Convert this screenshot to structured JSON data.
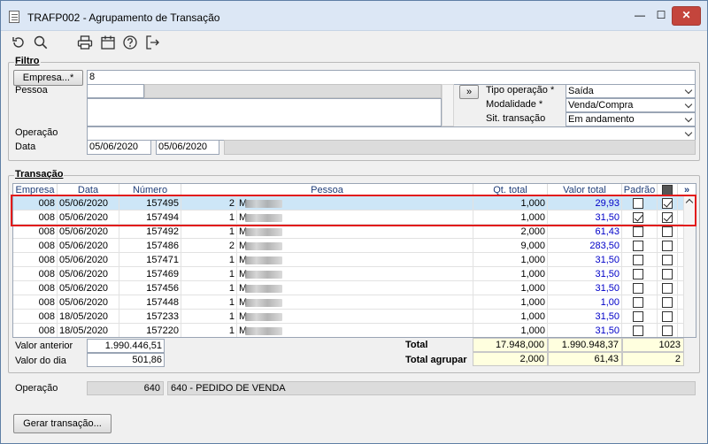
{
  "window": {
    "title": "TRAFP002 - Agrupamento de Transação",
    "minimize": "—",
    "maximize": "☐",
    "close": "✕"
  },
  "toolbar": {
    "icons": [
      "refresh-icon",
      "search-icon",
      "print-icon",
      "calendar-icon",
      "help-icon",
      "exit-icon"
    ]
  },
  "filtro": {
    "group_label": "Filtro",
    "empresa_button": "Empresa...*",
    "empresa_value": "8",
    "pessoa_label": "Pessoa",
    "pessoa_value": "",
    "expand_button": "»",
    "tipo_operacao_label": "Tipo operação *",
    "tipo_operacao_value": "Saída",
    "modalidade_label": "Modalidade *",
    "modalidade_value": "Venda/Compra",
    "sit_transacao_label": "Sit. transação",
    "sit_transacao_value": "Em andamento",
    "operacao_label": "Operação",
    "operacao_value": "",
    "data_label": "Data",
    "data_inicio": "05/06/2020",
    "data_fim": "05/06/2020"
  },
  "transacao": {
    "group_label": "Transação",
    "columns": {
      "empresa": "Empresa",
      "data": "Data",
      "numero": "Número",
      "pessoa": "Pessoa",
      "qt_total": "Qt. total",
      "valor_total": "Valor total",
      "padrao": "Padrão",
      "expand": "»"
    },
    "rows": [
      {
        "empresa": "008",
        "data": "05/06/2020",
        "numero": "157495",
        "n": "2",
        "pessoa": "M",
        "qt": "1,000",
        "valor": "29,93",
        "padrao": false,
        "agrupar": true,
        "selected": true
      },
      {
        "empresa": "008",
        "data": "05/06/2020",
        "numero": "157494",
        "n": "1",
        "pessoa": "M",
        "qt": "1,000",
        "valor": "31,50",
        "padrao": true,
        "agrupar": true,
        "selected": false
      },
      {
        "empresa": "008",
        "data": "05/06/2020",
        "numero": "157492",
        "n": "1",
        "pessoa": "M",
        "qt": "2,000",
        "valor": "61,43",
        "padrao": false,
        "agrupar": false,
        "selected": false
      },
      {
        "empresa": "008",
        "data": "05/06/2020",
        "numero": "157486",
        "n": "2",
        "pessoa": "M",
        "qt": "9,000",
        "valor": "283,50",
        "padrao": false,
        "agrupar": false,
        "selected": false
      },
      {
        "empresa": "008",
        "data": "05/06/2020",
        "numero": "157471",
        "n": "1",
        "pessoa": "M",
        "qt": "1,000",
        "valor": "31,50",
        "padrao": false,
        "agrupar": false,
        "selected": false
      },
      {
        "empresa": "008",
        "data": "05/06/2020",
        "numero": "157469",
        "n": "1",
        "pessoa": "M",
        "qt": "1,000",
        "valor": "31,50",
        "padrao": false,
        "agrupar": false,
        "selected": false
      },
      {
        "empresa": "008",
        "data": "05/06/2020",
        "numero": "157456",
        "n": "1",
        "pessoa": "M",
        "qt": "1,000",
        "valor": "31,50",
        "padrao": false,
        "agrupar": false,
        "selected": false
      },
      {
        "empresa": "008",
        "data": "05/06/2020",
        "numero": "157448",
        "n": "1",
        "pessoa": "M",
        "qt": "1,000",
        "valor": "1,00",
        "padrao": false,
        "agrupar": false,
        "selected": false
      },
      {
        "empresa": "008",
        "data": "18/05/2020",
        "numero": "157233",
        "n": "1",
        "pessoa": "M",
        "qt": "1,000",
        "valor": "31,50",
        "padrao": false,
        "agrupar": false,
        "selected": false
      },
      {
        "empresa": "008",
        "data": "18/05/2020",
        "numero": "157220",
        "n": "1",
        "pessoa": "M",
        "qt": "1,000",
        "valor": "31,50",
        "padrao": false,
        "agrupar": false,
        "selected": false
      }
    ]
  },
  "totais": {
    "valor_anterior_label": "Valor anterior",
    "valor_anterior": "1.990.446,51",
    "valor_dia_label": "Valor do dia",
    "valor_dia": "501,86",
    "total_label": "Total",
    "total_qt": "17.948,000",
    "total_valor": "1.990.948,37",
    "total_count": "1023",
    "agrupar_label": "Total agrupar",
    "agrupar_qt": "2,000",
    "agrupar_valor": "61,43",
    "agrupar_count": "2"
  },
  "operacao_footer": {
    "label": "Operação",
    "code": "640",
    "desc": "640 - PEDIDO DE VENDA"
  },
  "gerar_button": "Gerar transação..."
}
